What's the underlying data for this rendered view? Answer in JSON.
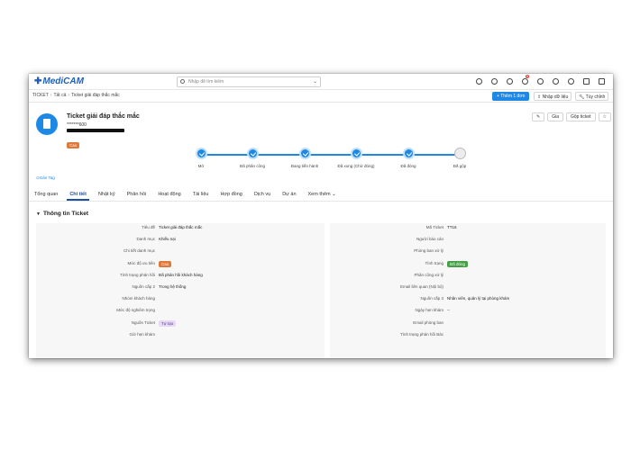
{
  "app": {
    "logo_text": "MediCAM"
  },
  "search": {
    "placeholder": "Nhập để tìm kiếm"
  },
  "breadcrumb": [
    "TICKET",
    "Tất cả",
    "Ticket giải đáp thắc mắc"
  ],
  "toolbar": {
    "add_button": "+ Thêm 1 đơn",
    "import_button": "Nhập dữ liệu",
    "custom_button": "Tùy chỉnh"
  },
  "notifications": {
    "count": "8"
  },
  "header": {
    "title": "Ticket giải đáp thắc mắc",
    "phone": "*******600",
    "priority": "Cao",
    "actions": {
      "edit": "✎",
      "share": "Gia",
      "merge": "Gộp ticket",
      "star": "☆"
    }
  },
  "stepper": {
    "steps": [
      {
        "label": "Mở",
        "done": true
      },
      {
        "label": "Đã phân công",
        "done": true
      },
      {
        "label": "Đang tiến hành",
        "done": true
      },
      {
        "label": "Đã xong (Chờ đóng)",
        "done": true
      },
      {
        "label": "Đã đóng",
        "done": true
      },
      {
        "label": "Đã gộp",
        "done": false
      }
    ]
  },
  "add_tag": "Gán Tag",
  "tabs": [
    "Tổng quan",
    "Chi tiết",
    "Nhật ký",
    "Phản hồi",
    "Hoạt động",
    "Tài liệu",
    "Hợp đồng",
    "Dịch vụ",
    "Dự án",
    "Xem thêm"
  ],
  "active_tab": "Chi tiết",
  "section": {
    "title": "Thông tin Ticket"
  },
  "details_left": [
    {
      "label": "Tiêu đề",
      "value": "Ticket giải đáp thắc mắc"
    },
    {
      "label": "Danh mục",
      "value": "Khiếu nại"
    },
    {
      "label": "Chi tiết danh mục",
      "value": ""
    },
    {
      "label": "Mức độ ưu tiên",
      "value": "Cao",
      "pill": "orange"
    },
    {
      "label": "Tình trạng phản hồi",
      "value": "Đã phản hồi khách hàng"
    },
    {
      "label": "Nguồn cấp 2",
      "value": "Trong hệ thống"
    },
    {
      "label": "Nhóm khách hàng",
      "value": ""
    },
    {
      "label": "Mức độ nghiêm trọng",
      "value": ""
    },
    {
      "label": "Nguồn Ticket",
      "value": "Tự tạo",
      "pill": "purple"
    },
    {
      "label": "Giờ hẹn khám",
      "value": ""
    }
  ],
  "details_right": [
    {
      "label": "Mã Ticket",
      "value": "TT16"
    },
    {
      "label": "Người báo cáo",
      "value": ""
    },
    {
      "label": "Phòng ban xử lý",
      "value": ""
    },
    {
      "label": "Tình trạng",
      "value": "Đã đóng",
      "pill": "green"
    },
    {
      "label": "Phân công xử lý",
      "value": ""
    },
    {
      "label": "Email liên quan (Nội bộ)",
      "value": ""
    },
    {
      "label": "Nguồn cấp 3",
      "value": "Nhân viên, quản lý tại phòng khám"
    },
    {
      "label": "Ngày hẹn khám",
      "value": "--"
    },
    {
      "label": "Email phòng ban",
      "value": ""
    },
    {
      "label": "Tình trạng phản hồi Bác",
      "value": ""
    }
  ],
  "colors": {
    "primary": "#1e88e5",
    "priority": "#e0783a",
    "closed": "#43a047"
  }
}
